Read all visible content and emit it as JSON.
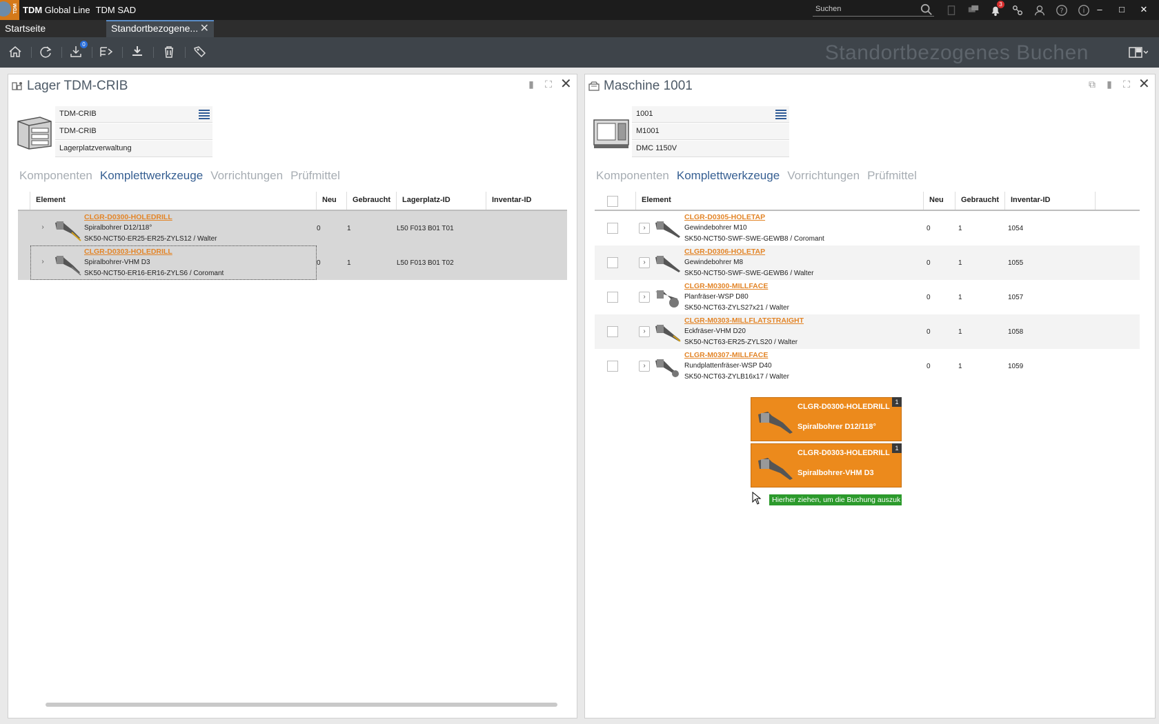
{
  "titlebar": {
    "brand": "TDM",
    "product": "Global Line",
    "module": "TDM SAD",
    "search_placeholder": "Suchen",
    "notification_count": "3",
    "window_controls": [
      "–",
      "□",
      "✕"
    ]
  },
  "tabs": [
    {
      "label": "Startseite",
      "active": false
    },
    {
      "label": "Standortbezogene...",
      "active": true,
      "close": "✕"
    }
  ],
  "toolbar": {
    "import_badge": "0",
    "heading": "Standortbezogenes Buchen"
  },
  "left_panel": {
    "title": "Lager TDM-CRIB",
    "fields": [
      "TDM-CRIB",
      "TDM-CRIB",
      "Lagerplatzverwaltung"
    ],
    "subtabs": [
      "Komponenten",
      "Komplettwerkzeuge",
      "Vorrichtungen",
      "Prüfmittel"
    ],
    "active_subtab": "Komplettwerkzeuge",
    "columns": [
      "Element",
      "Neu",
      "Gebraucht",
      "Lagerplatz-ID",
      "Inventar-ID"
    ],
    "rows": [
      {
        "id": "CLGR-D0300-HOLEDRILL",
        "name": "Spiralbohrer D12/118°",
        "desc": "SK50-NCT50-ER25-ER25-ZYLS12 / Walter",
        "neu": "0",
        "gebraucht": "1",
        "lagerplatz": "L50 F013 B01 T01",
        "inventar": ""
      },
      {
        "id": "CLGR-D0303-HOLEDRILL",
        "name": "Spiralbohrer-VHM D3",
        "desc": "SK50-NCT50-ER16-ER16-ZYLS6 / Coromant",
        "neu": "0",
        "gebraucht": "1",
        "lagerplatz": "L50 F013 B01 T02",
        "inventar": ""
      }
    ]
  },
  "right_panel": {
    "title": "Maschine 1001",
    "fields": [
      "1001",
      "M1001",
      "DMC 1150V"
    ],
    "subtabs": [
      "Komponenten",
      "Komplettwerkzeuge",
      "Vorrichtungen",
      "Prüfmittel"
    ],
    "active_subtab": "Komplettwerkzeuge",
    "columns": [
      "Element",
      "Neu",
      "Gebraucht",
      "Inventar-ID"
    ],
    "rows": [
      {
        "id": "CLGR-D0305-HOLETAP",
        "name": "Gewindebohrer M10",
        "desc": "SK50-NCT50-SWF-SWE-GEWB8 / Coromant",
        "neu": "0",
        "gebraucht": "1",
        "inventar": "1054"
      },
      {
        "id": "CLGR-D0306-HOLETAP",
        "name": "Gewindebohrer M8",
        "desc": "SK50-NCT50-SWF-SWE-GEWB6 / Walter",
        "neu": "0",
        "gebraucht": "1",
        "inventar": "1055"
      },
      {
        "id": "CLGR-M0300-MILLFACE",
        "name": "Planfräser-WSP D80",
        "desc": "SK50-NCT63-ZYLS27x21 / Walter",
        "neu": "0",
        "gebraucht": "1",
        "inventar": "1057"
      },
      {
        "id": "CLGR-M0303-MILLFLATSTRAIGHT",
        "name": "Eckfräser-VHM D20",
        "desc": "SK50-NCT63-ER25-ZYLS20 / Walter",
        "neu": "0",
        "gebraucht": "1",
        "inventar": "1058"
      },
      {
        "id": "CLGR-M0307-MILLFACE",
        "name": "Rundplattenfräser-WSP D40",
        "desc": "SK50-NCT63-ZYLB16x17 / Walter",
        "neu": "0",
        "gebraucht": "1",
        "inventar": "1059"
      }
    ]
  },
  "drag": {
    "items": [
      {
        "id": "CLGR-D0300-HOLEDRILL",
        "name": "Spiralbohrer D12/118°",
        "count": "1"
      },
      {
        "id": "CLGR-D0303-HOLEDRILL",
        "name": "Spiralbohrer-VHM D3",
        "count": "1"
      }
    ],
    "hint": "Hierher ziehen, um die Buchung auszuk"
  },
  "colors": {
    "accent_orange": "#ec8a1c",
    "link_orange": "#e38528",
    "active_blue": "#365f92",
    "hint_green": "#2c9a2c"
  }
}
